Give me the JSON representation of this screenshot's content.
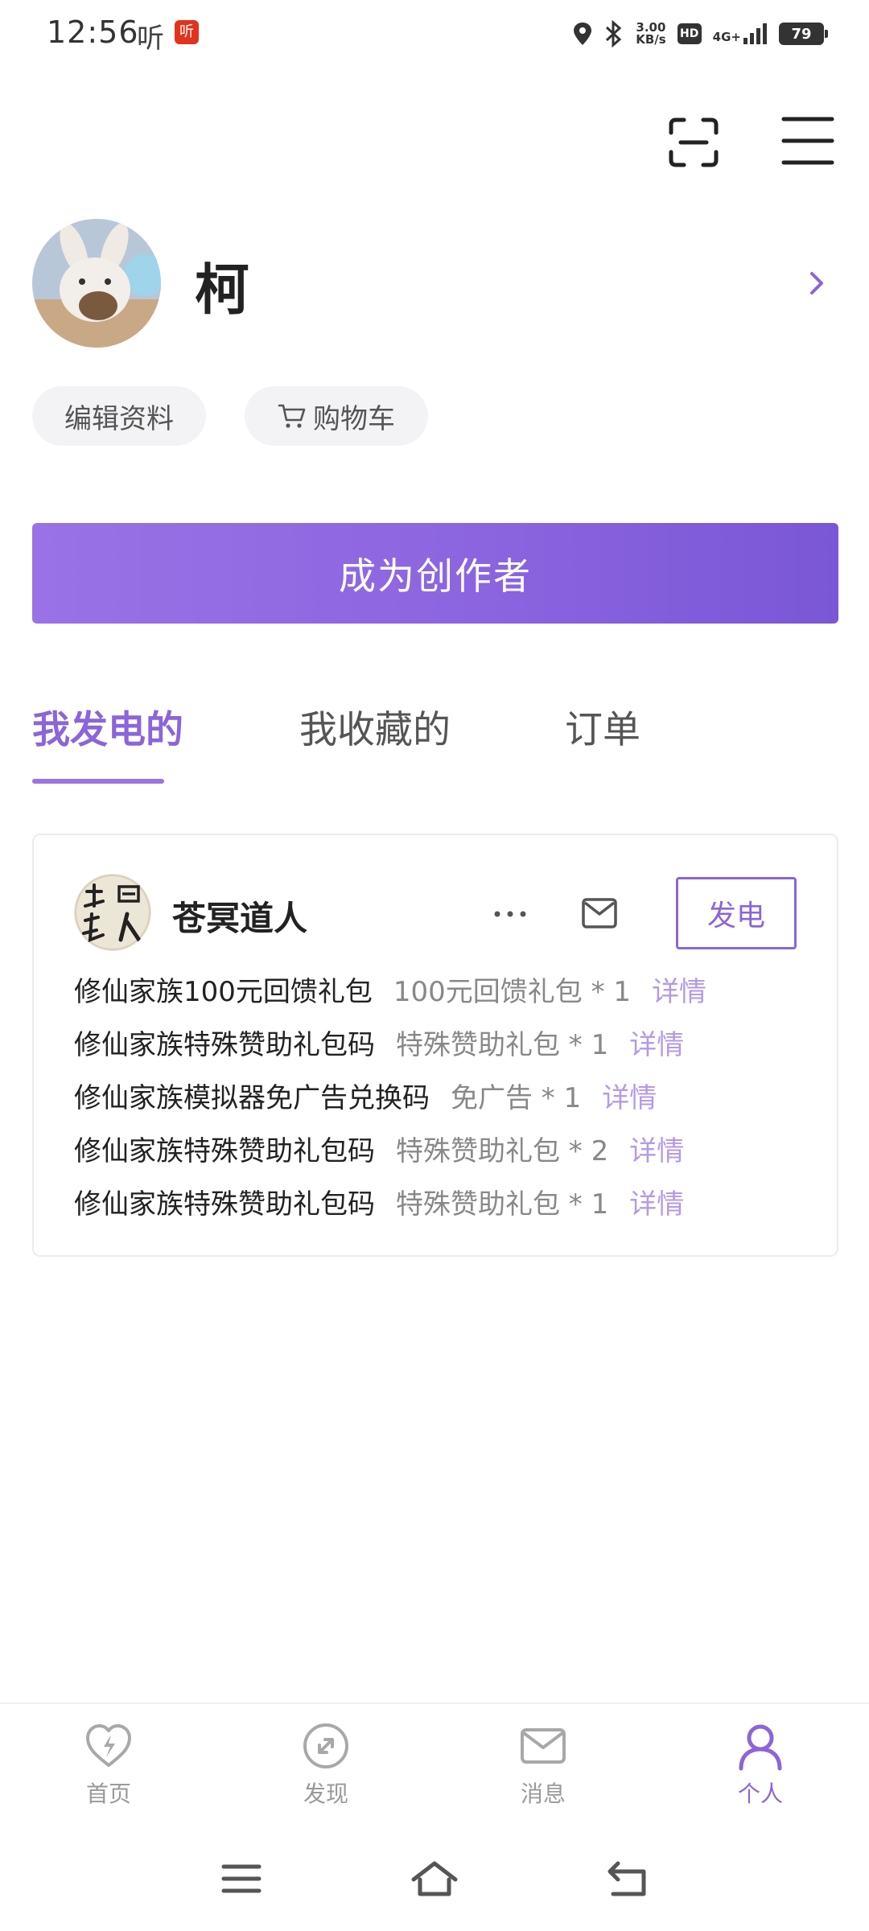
{
  "status_bar": {
    "time": "12:56",
    "ting": "听",
    "app_badge": "听",
    "speed_value": "3.00",
    "speed_unit": "KB/s",
    "hd": "HD",
    "network": "4G+",
    "battery": "79"
  },
  "profile": {
    "username": "柯",
    "edit_label": "编辑资料",
    "cart_label": "购物车"
  },
  "creator_button": "成为创作者",
  "tabs": [
    {
      "label": "我发电的",
      "active": true
    },
    {
      "label": "我收藏的",
      "active": false
    },
    {
      "label": "订单",
      "active": false
    }
  ],
  "card": {
    "creator_name": "苍冥道人",
    "avatar_text": "苍冥道人",
    "fadian_label": "发电",
    "items": [
      {
        "name": "修仙家族100元回馈礼包",
        "gift": "100元回馈礼包 * 1",
        "detail": "详情"
      },
      {
        "name": "修仙家族特殊赞助礼包码",
        "gift": "特殊赞助礼包 * 1",
        "detail": "详情"
      },
      {
        "name": "修仙家族模拟器免广告兑换码",
        "gift": "免广告 * 1",
        "detail": "详情"
      },
      {
        "name": "修仙家族特殊赞助礼包码",
        "gift": "特殊赞助礼包 * 2",
        "detail": "详情"
      },
      {
        "name": "修仙家族特殊赞助礼包码",
        "gift": "特殊赞助礼包 * 1",
        "detail": "详情"
      }
    ]
  },
  "bottom_nav": [
    {
      "label": "首页",
      "icon": "heart-bolt-icon",
      "active": false
    },
    {
      "label": "发现",
      "icon": "compass-icon",
      "active": false
    },
    {
      "label": "消息",
      "icon": "mail-icon",
      "active": false
    },
    {
      "label": "个人",
      "icon": "person-icon",
      "active": true
    }
  ],
  "colors": {
    "accent": "#8b65d9",
    "accent_light": "#b49ae8",
    "pill_bg": "#f3f3f5"
  }
}
